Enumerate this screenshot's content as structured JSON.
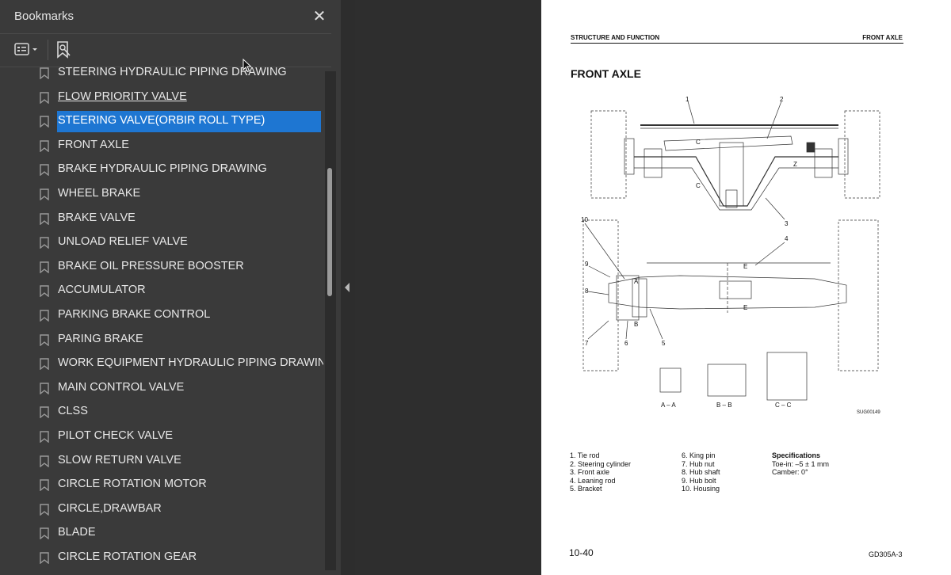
{
  "bookmarks_panel": {
    "title": "Bookmarks",
    "close_icon": "close-icon",
    "toolbar": {
      "options_icon": "bookmark-options-icon",
      "add_icon": "add-bookmark-icon"
    },
    "items": [
      {
        "label": "STEERING HYDRAULIC PIPING DRAWING"
      },
      {
        "label": "FLOW PRIORITY VALVE"
      },
      {
        "label": "STEERING VALVE(ORBIR ROLL TYPE)"
      },
      {
        "label": "FRONT AXLE"
      },
      {
        "label": "BRAKE HYDRAULIC PIPING DRAWING"
      },
      {
        "label": "WHEEL BRAKE"
      },
      {
        "label": "BRAKE VALVE"
      },
      {
        "label": "UNLOAD RELIEF VALVE"
      },
      {
        "label": "BRAKE OIL PRESSURE BOOSTER"
      },
      {
        "label": "ACCUMULATOR"
      },
      {
        "label": "PARKING BRAKE CONTROL"
      },
      {
        "label": "PARING BRAKE"
      },
      {
        "label": "WORK EQUIPMENT HYDRAULIC PIPING DRAWING"
      },
      {
        "label": "MAIN CONTROL VALVE"
      },
      {
        "label": "CLSS"
      },
      {
        "label": "PILOT CHECK VALVE"
      },
      {
        "label": "SLOW RETURN VALVE"
      },
      {
        "label": "CIRCLE ROTATION MOTOR"
      },
      {
        "label": "CIRCLE,DRAWBAR"
      },
      {
        "label": "BLADE"
      },
      {
        "label": "CIRCLE ROTATION GEAR"
      }
    ],
    "selected_index": 2,
    "hovered_index": 1
  },
  "page": {
    "header_left": "STRUCTURE AND FUNCTION",
    "header_right": "FRONT AXLE",
    "title": "FRONT AXLE",
    "drawing": {
      "callouts": [
        "1",
        "2",
        "3",
        "4",
        "5",
        "6",
        "7",
        "8",
        "9",
        "10"
      ],
      "section_markers": [
        "C",
        "C",
        "Z",
        "E",
        "E",
        "A",
        "A",
        "B",
        "B"
      ],
      "sections": [
        "A – A",
        "B – B",
        "C – C"
      ],
      "drawing_code": "SUG00149"
    },
    "legend_col1": [
      "1.   Tie rod",
      "2.   Steering cylinder",
      "3.   Front axle",
      "4.   Leaning rod",
      "5.   Bracket"
    ],
    "legend_col2": [
      "6.  King pin",
      "7.  Hub nut",
      "8.  Hub shaft",
      "9.  Hub bolt",
      "10. Housing"
    ],
    "specifications": {
      "title": "Specifications",
      "toe_in": "Toe-in: –5 ± 1 mm",
      "camber": "Camber: 0°"
    },
    "page_number": "10-40",
    "model_code": "GD305A-3"
  },
  "colors": {
    "selection": "#1e76d2",
    "panel": "#3a3a3a",
    "page": "#ffffff"
  }
}
